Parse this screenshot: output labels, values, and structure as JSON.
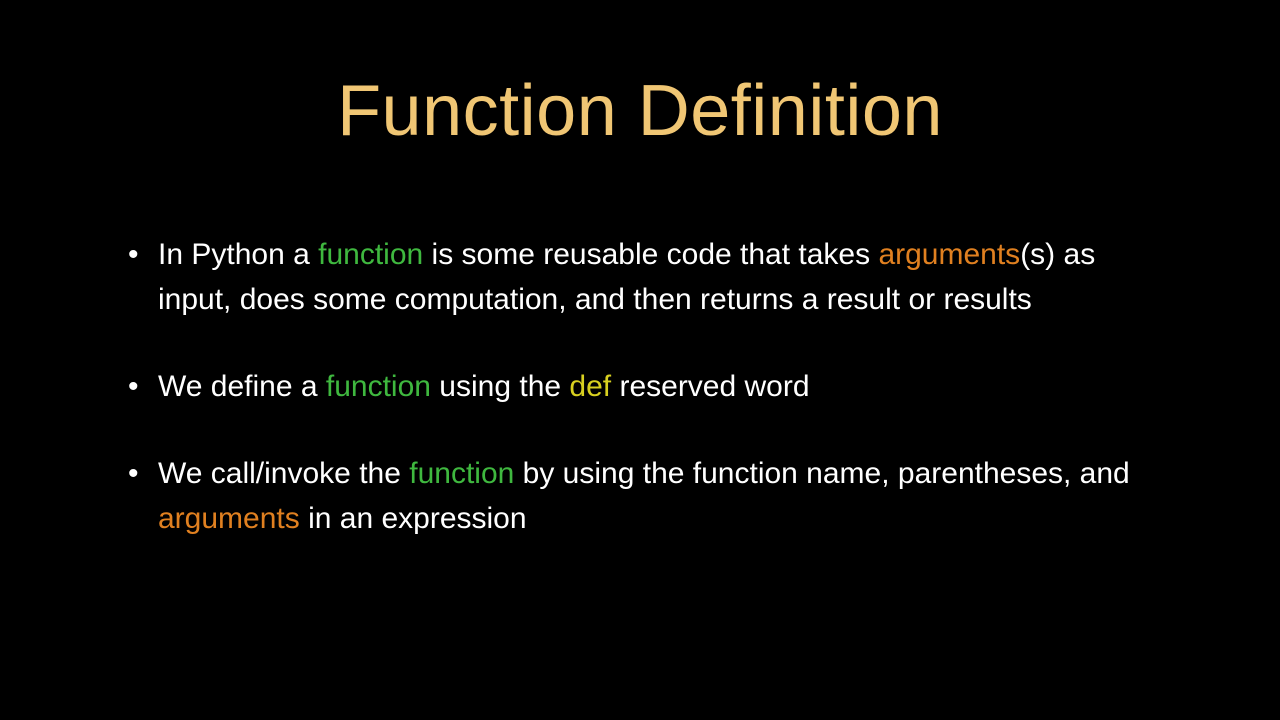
{
  "title": "Function Definition",
  "bullets": [
    {
      "segments": [
        {
          "text": "In Python a ",
          "cls": ""
        },
        {
          "text": "function",
          "cls": "kw-green"
        },
        {
          "text": " is some reusable code that takes ",
          "cls": ""
        },
        {
          "text": "arguments",
          "cls": "kw-orange"
        },
        {
          "text": "(s) as input, does some computation, and then returns a result or results",
          "cls": ""
        }
      ]
    },
    {
      "segments": [
        {
          "text": "We define a ",
          "cls": ""
        },
        {
          "text": "function",
          "cls": "kw-green"
        },
        {
          "text": " using the ",
          "cls": ""
        },
        {
          "text": "def",
          "cls": "kw-yellow"
        },
        {
          "text": " reserved word",
          "cls": ""
        }
      ]
    },
    {
      "segments": [
        {
          "text": "We call/invoke the ",
          "cls": ""
        },
        {
          "text": "function",
          "cls": "kw-green"
        },
        {
          "text": " by using the function name, parentheses, and ",
          "cls": ""
        },
        {
          "text": "arguments",
          "cls": "kw-orange"
        },
        {
          "text": " in an expression",
          "cls": ""
        }
      ]
    }
  ]
}
